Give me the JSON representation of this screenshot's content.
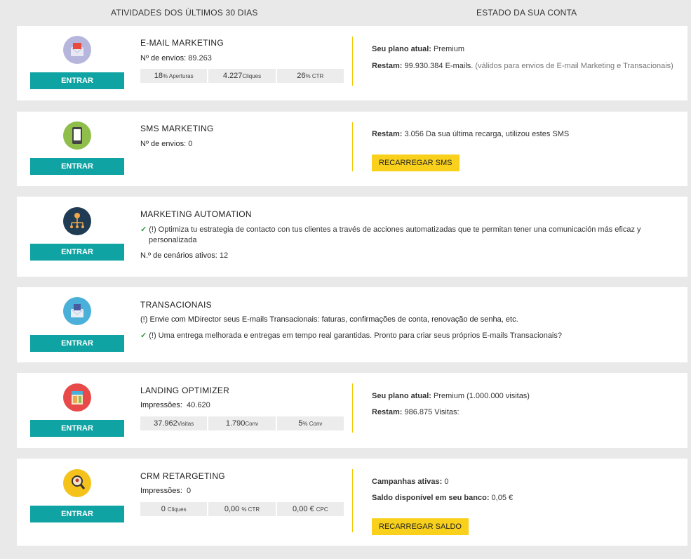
{
  "headers": {
    "left": "ATIVIDADES DOS ÚLTIMOS 30 DIAS",
    "right": "ESTADO DA SUA CONTA"
  },
  "enter_label": "ENTRAR",
  "email": {
    "title": "E-MAIL MARKETING",
    "sends_label": "Nº de envios:",
    "sends_value": "89.263",
    "stats": [
      {
        "value": "18",
        "unit": "% Aperturas"
      },
      {
        "value": "4.227",
        "unit": "Cliques"
      },
      {
        "value": "26",
        "unit": "% CTR"
      }
    ],
    "plan_label": "Seu plano atual:",
    "plan_value": "Premium",
    "remain_label": "Restam:",
    "remain_value": "99.930.384 E-mails.",
    "remain_note": "(válidos para envios de E-mail Marketing e Transacionais)"
  },
  "sms": {
    "title": "SMS MARKETING",
    "sends_label": "Nº de envios:",
    "sends_value": "0",
    "remain_label": "Restam:",
    "remain_value": "3.056 Da sua última recarga, utilizou estes SMS",
    "recharge_label": "RECARREGAR SMS"
  },
  "automation": {
    "title": "MARKETING AUTOMATION",
    "note_line1": "(!) Optimiza tu estrategia de contacto con tus clientes a través de acciones automatizadas que te permitan tener una comunicación más eficaz y",
    "note_line2": "personalizada",
    "scenarios_label": "N.º de cenários ativos:",
    "scenarios_value": "12"
  },
  "transactional": {
    "title": "TRANSACIONAIS",
    "info": "(!) Envie com MDirector seus E-mails Transacionais: faturas, confirmações de conta, renovação de senha, etc.",
    "note": "(!) Uma entrega melhorada e entregas em tempo real garantidas. Pronto para criar seus próprios E-mails Transacionais?"
  },
  "landing": {
    "title": "LANDING OPTIMIZER",
    "impressions_label": "Impressões:",
    "impressions_value": "40.620",
    "stats": [
      {
        "value": "37.962",
        "unit": "Visitas"
      },
      {
        "value": "1.790",
        "unit": "Conv"
      },
      {
        "value": "5",
        "unit": "% Conv"
      }
    ],
    "plan_label": "Seu plano atual:",
    "plan_value": "Premium (1.000.000 visitas)",
    "remain_label": "Restam:",
    "remain_value": "986.875 Visitas:"
  },
  "crm": {
    "title": "CRM RETARGETING",
    "impressions_label": "Impressões:",
    "impressions_value": "0",
    "stats": [
      {
        "value": "0",
        "unit": "Cliques"
      },
      {
        "value": "0,00",
        "unit": "% CTR"
      },
      {
        "value": "0,00 €",
        "unit": "CPC"
      }
    ],
    "campaigns_label": "Campanhas ativas:",
    "campaigns_value": "0",
    "balance_label": "Saldo disponível em seu banco:",
    "balance_value": "0,05 €",
    "recharge_label": "RECARREGAR SALDO"
  }
}
